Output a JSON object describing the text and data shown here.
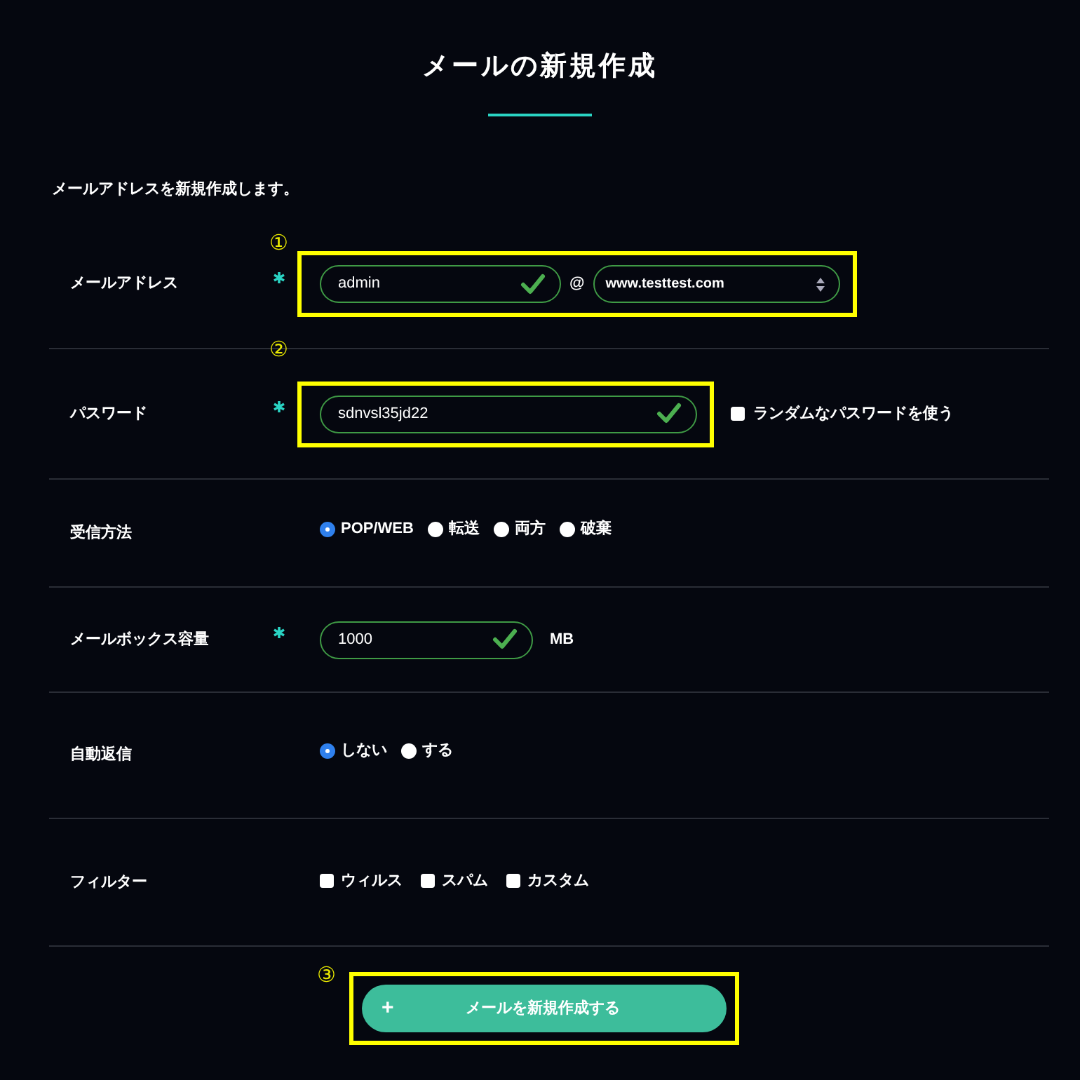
{
  "dialog": {
    "title": "メールの新規作成",
    "description": "メールアドレスを新規作成します。",
    "fields": [
      {
        "kind": "email",
        "label": "メールアドレス",
        "required": true,
        "annotation": "①",
        "value": "admin",
        "valid": true,
        "at": "@",
        "domain": "www.testtest.com"
      },
      {
        "kind": "password",
        "label": "パスワード",
        "required": true,
        "annotation": "②",
        "value": "sdnvsl35jd22",
        "valid": true,
        "option": {
          "label": "ランダムなパスワードを使う",
          "checked": false
        }
      },
      {
        "kind": "radio",
        "label": "受信方法",
        "options": [
          {
            "label": "POP/WEB",
            "selected": true
          },
          {
            "label": "転送",
            "selected": false
          },
          {
            "label": "両方",
            "selected": false
          },
          {
            "label": "破棄",
            "selected": false
          }
        ]
      },
      {
        "kind": "quota",
        "label": "メールボックス容量",
        "required": true,
        "value": "1000",
        "valid": true,
        "unit": "MB"
      },
      {
        "kind": "radio",
        "label": "自動返信",
        "options": [
          {
            "label": "しない",
            "selected": true
          },
          {
            "label": "する",
            "selected": false
          }
        ]
      },
      {
        "kind": "checkbox",
        "label": "フィルター",
        "options": [
          {
            "label": "ウィルス",
            "checked": false
          },
          {
            "label": "スパム",
            "checked": false
          },
          {
            "label": "カスタム",
            "checked": false
          }
        ]
      }
    ],
    "submit": {
      "icon": "+",
      "label": "メールを新規作成する",
      "annotation": "③"
    }
  }
}
